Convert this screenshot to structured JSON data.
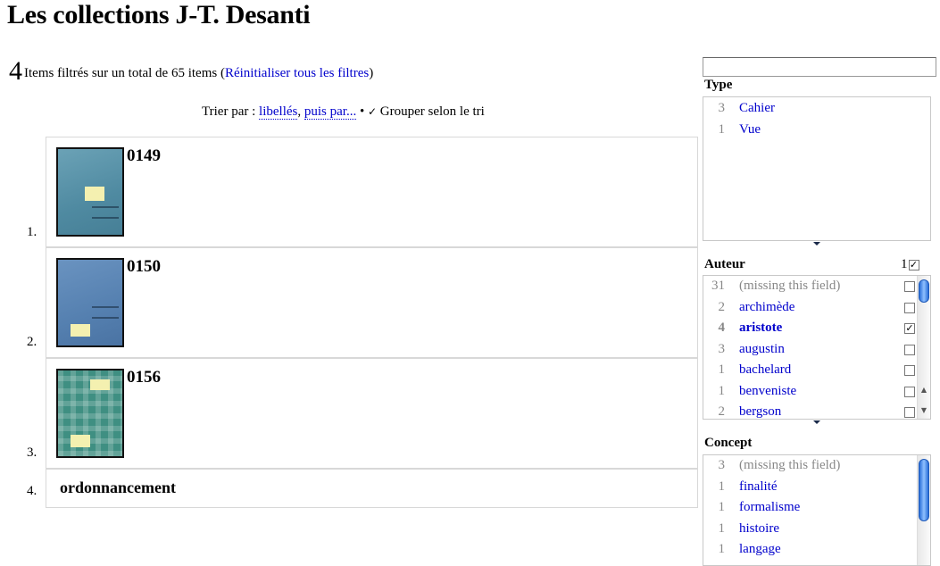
{
  "page_title": "Les collections J-T. Desanti",
  "summary": {
    "count": "4",
    "text": "Items filtrés sur un total de 65 items (",
    "reset_link": "Réinitialiser tous les filtres",
    "close_paren": ")"
  },
  "sort": {
    "prefix": "Trier par : ",
    "primary_link": "libellés",
    "comma": ", ",
    "secondary_link": "puis par...",
    "bullet": " • ",
    "group_check": "✓",
    "group_label": " Grouper selon le tri"
  },
  "items": [
    {
      "num": "1.",
      "label": "0149"
    },
    {
      "num": "2.",
      "label": "0150"
    },
    {
      "num": "3.",
      "label": "0156"
    },
    {
      "num": "4.",
      "label": "ordonnancement"
    }
  ],
  "facets": {
    "type": {
      "title": "Type",
      "values": [
        {
          "count": "3",
          "label": "Cahier"
        },
        {
          "count": "1",
          "label": "Vue"
        }
      ]
    },
    "auteur": {
      "title": "Auteur",
      "selected_count": "1",
      "selected_check": "✓",
      "values": [
        {
          "count": "31",
          "label": "(missing this field)",
          "checked": false
        },
        {
          "count": "2",
          "label": "archimède",
          "checked": false
        },
        {
          "count": "4",
          "label": "aristote",
          "checked": true
        },
        {
          "count": "3",
          "label": "augustin",
          "checked": false
        },
        {
          "count": "1",
          "label": "bachelard",
          "checked": false
        },
        {
          "count": "1",
          "label": "benveniste",
          "checked": false
        },
        {
          "count": "2",
          "label": "bergson",
          "checked": false
        }
      ]
    },
    "concept": {
      "title": "Concept",
      "values": [
        {
          "count": "3",
          "label": "(missing this field)"
        },
        {
          "count": "1",
          "label": "finalité"
        },
        {
          "count": "1",
          "label": "formalisme"
        },
        {
          "count": "1",
          "label": "histoire"
        },
        {
          "count": "1",
          "label": "langage"
        }
      ]
    }
  },
  "colors": {
    "link": "#0000cc",
    "muted": "#888888",
    "scroll_thumb": "#2a6ed8"
  }
}
